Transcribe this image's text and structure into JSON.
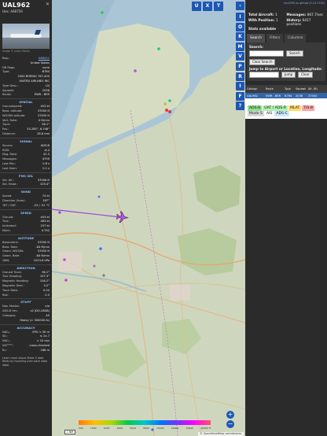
{
  "left": {
    "callsign": "UAL962",
    "hex_label": "Hex: A88759",
    "close": "✕",
    "photo_credit": "Image © Julian Martin",
    "rows_top": [
      {
        "k": "Reg.:",
        "v": "N66051",
        "link": true
      },
      {
        "k": "",
        "v": "United States"
      },
      {
        "k": "DB flags:",
        "v": "none"
      },
      {
        "k": "Type:",
        "v": "B764"
      },
      {
        "k": "",
        "v": "2000 BOEING 767-400"
      },
      {
        "k": "",
        "v": "UNITED AIRLINES INC"
      },
      {
        "k": "Type Desc.:",
        "v": "L2J"
      },
      {
        "k": "Squawk:",
        "v": "2036"
      },
      {
        "k": "Route:",
        "v": "EWR - BER"
      }
    ],
    "sections": [
      {
        "title": "SPATIAL",
        "rows": [
          {
            "k": "Groundspeed:",
            "v": "453 kt"
          },
          {
            "k": "Baro. altitude:",
            "v": "37000 ft"
          },
          {
            "k": "WGS84 altitude:",
            "v": "37450 ft"
          },
          {
            "k": "Vert. Rate:",
            "v": "0 ft/min"
          },
          {
            "k": "Track:",
            "v": "96.1°"
          },
          {
            "k": "Pos.:",
            "v": "53.285°, 6.708°"
          },
          {
            "k": "Distance:",
            "v": "28.8 nmi"
          }
        ]
      },
      {
        "title": "SIGNAL",
        "rows": [
          {
            "k": "Source:",
            "v": "ADS-B"
          },
          {
            "k": "RSSI:",
            "v": "-6.4"
          },
          {
            "k": "Msg. Rate:",
            "v": "41.5"
          },
          {
            "k": "Messages:",
            "v": "4799"
          },
          {
            "k": "Last Pos.:",
            "v": "0.8 s"
          },
          {
            "k": "Last Seen:",
            "v": "0.1 s"
          }
        ]
      },
      {
        "title": "FMS SEL",
        "rows": [
          {
            "k": "Sel. Alt.:",
            "v": "37008 ft"
          },
          {
            "k": "Sel. Head.:",
            "v": "103.4°"
          }
        ]
      },
      {
        "title": "WIND",
        "rows": [
          {
            "k": "Speed:",
            "v": "74 kt"
          },
          {
            "k": "Direction (from):",
            "v": "187°"
          },
          {
            "k": "TAT / OAT:",
            "v": "-23 / -51 °C"
          }
        ]
      },
      {
        "title": "SPEED",
        "rows": [
          {
            "k": "Ground:",
            "v": "453 kt"
          },
          {
            "k": "True:",
            "v": "463 kt"
          },
          {
            "k": "Indicated:",
            "v": "257 kt"
          },
          {
            "k": "Mach:",
            "v": "0.792"
          }
        ]
      },
      {
        "title": "ALTITUDE",
        "rows": [
          {
            "k": "Barometric:",
            "v": "37000 ft"
          },
          {
            "k": "Baro. Rate:",
            "v": "-64 ft/min"
          },
          {
            "k": "Geom. WGS84:",
            "v": "37450 ft"
          },
          {
            "k": "Geom. Rate:",
            "v": "-64 ft/min"
          },
          {
            "k": "QNH:",
            "v": "1013.6 hPa"
          }
        ]
      },
      {
        "title": "DIRECTION",
        "rows": [
          {
            "k": "Ground Track:",
            "v": "96.1°"
          },
          {
            "k": "True Heading:",
            "v": "107.3°"
          },
          {
            "k": "Magnetic Heading:",
            "v": "104.2°"
          },
          {
            "k": "Magnetic Decl.:",
            "v": "3.2°"
          },
          {
            "k": "Track Rate:",
            "v": "0.00"
          },
          {
            "k": "Roll:",
            "v": "0.5"
          }
        ]
      },
      {
        "title": "STUFF",
        "rows": [
          {
            "k": "Nav. Modes:",
            "v": "n/a"
          },
          {
            "k": "ADS-B Ver.:",
            "v": "v2 (DO-260B)"
          },
          {
            "k": "Category:",
            "v": "A5"
          },
          {
            "k": "",
            "v": "Heavy (> 300000 lb)"
          }
        ]
      },
      {
        "title": "ACCURACY",
        "rows": [
          {
            "k": "NACₚ:",
            "v": "EPU < 30 m"
          },
          {
            "k": "SIL:",
            "v": "≤ 1e-7"
          },
          {
            "k": "NACᵥ:",
            "v": "< 10 m/s"
          },
          {
            "k": "NICᴮᴬᴿᴼ:",
            "v": "cross-checked"
          },
          {
            "k": "Rc:",
            "v": "186 m"
          }
        ]
      }
    ],
    "footer": "Learn more about Mode S data fields by hovering over each data label."
  },
  "map": {
    "top_buttons": [
      "U",
      "X",
      "T"
    ],
    "scale": "1 NM",
    "alt_labels": [
      "500",
      "1000",
      "2000",
      "4000",
      "6000",
      "8000",
      "10000",
      "20000",
      "30000",
      "40000 ft"
    ],
    "attribution": "© OpenStreetMap contributors.",
    "zoom_in": "+",
    "zoom_out": "−"
  },
  "toolbar": {
    "buttons": [
      "‹",
      "I",
      "O",
      "K",
      "M",
      "V",
      "P",
      "R",
      "I",
      "F",
      "?"
    ]
  },
  "right": {
    "top_link": "tar1090 on github (3.14.1732)",
    "stats": [
      {
        "label": "Total Aircraft:",
        "value": "1"
      },
      {
        "label": "Messages:",
        "value": "867.7/sec"
      },
      {
        "label": "With Position:",
        "value": "1"
      },
      {
        "label": "History:",
        "value": "6417 positions"
      }
    ],
    "stats_available": "Stats available",
    "tabs": [
      "Search",
      "Filters",
      "Columns"
    ],
    "search_label": "Search:",
    "search_button": "Search",
    "clear_search_button": "Clear Search",
    "jump_label": "Jump to Airport or Location, Longitude:",
    "jump_button": "Jump",
    "clear_button": "Clear",
    "table_headers": [
      "Callsign",
      "Route",
      "Type",
      "Squawk",
      "Alt. (ft)"
    ],
    "table_row": [
      "UAL962",
      "EWR - BER",
      "B764",
      "2036",
      "37000"
    ],
    "legend": [
      "ADS-B",
      "UAT / ADS-R",
      "MLAT",
      "TIS-B",
      "Mode S",
      "AIS",
      "ADS-C"
    ]
  },
  "colors": {
    "accent": "#1d57b5",
    "selected_row": "#3264a8",
    "track": "#9a3fe0"
  }
}
